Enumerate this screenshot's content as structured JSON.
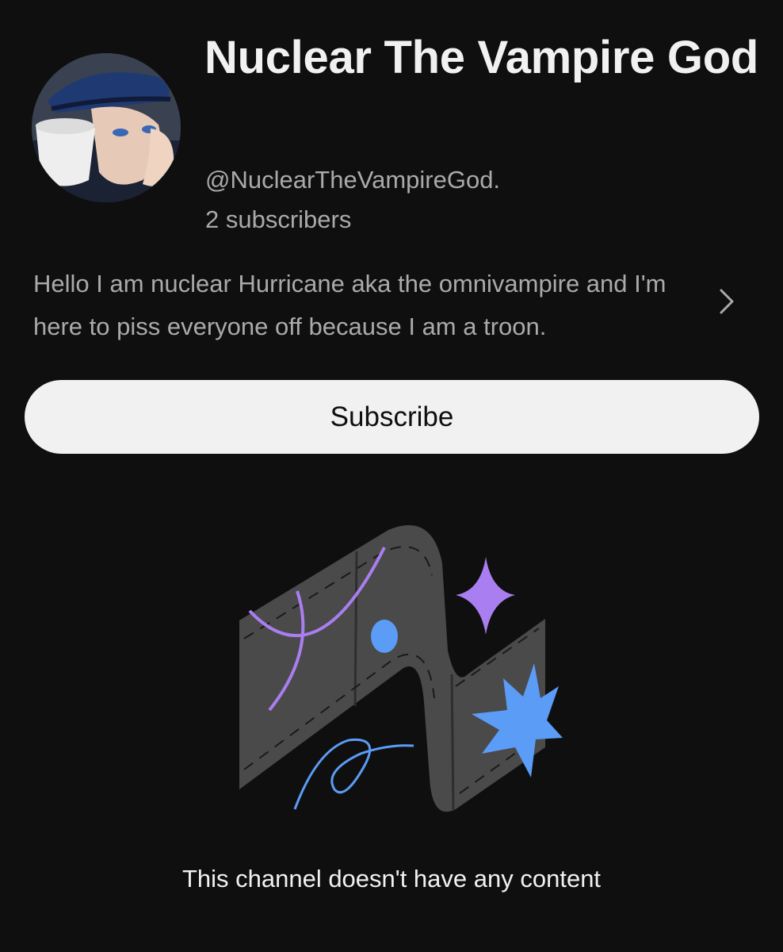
{
  "channel": {
    "name": "Nuclear The Vampire God",
    "handle": "@NuclearTheVampireGod.",
    "subscribers": "2 subscribers",
    "description": "Hello I am nuclear Hurricane aka the omnivampire and I'm here to piss everyone off because I am a troon."
  },
  "actions": {
    "subscribe_label": "Subscribe"
  },
  "empty_state": {
    "message": "This channel doesn't have any content",
    "illustration_icon": "empty-channel-illustration"
  },
  "icons": {
    "description_expand": "chevron-right-icon",
    "avatar": "avatar"
  },
  "colors": {
    "background": "#0f0f0f",
    "text_primary": "#f1f1f1",
    "text_secondary": "#aaaaaa",
    "button_bg": "#f1f1f1",
    "accent_purple": "#a97ef0",
    "accent_blue": "#5b9cf7"
  }
}
